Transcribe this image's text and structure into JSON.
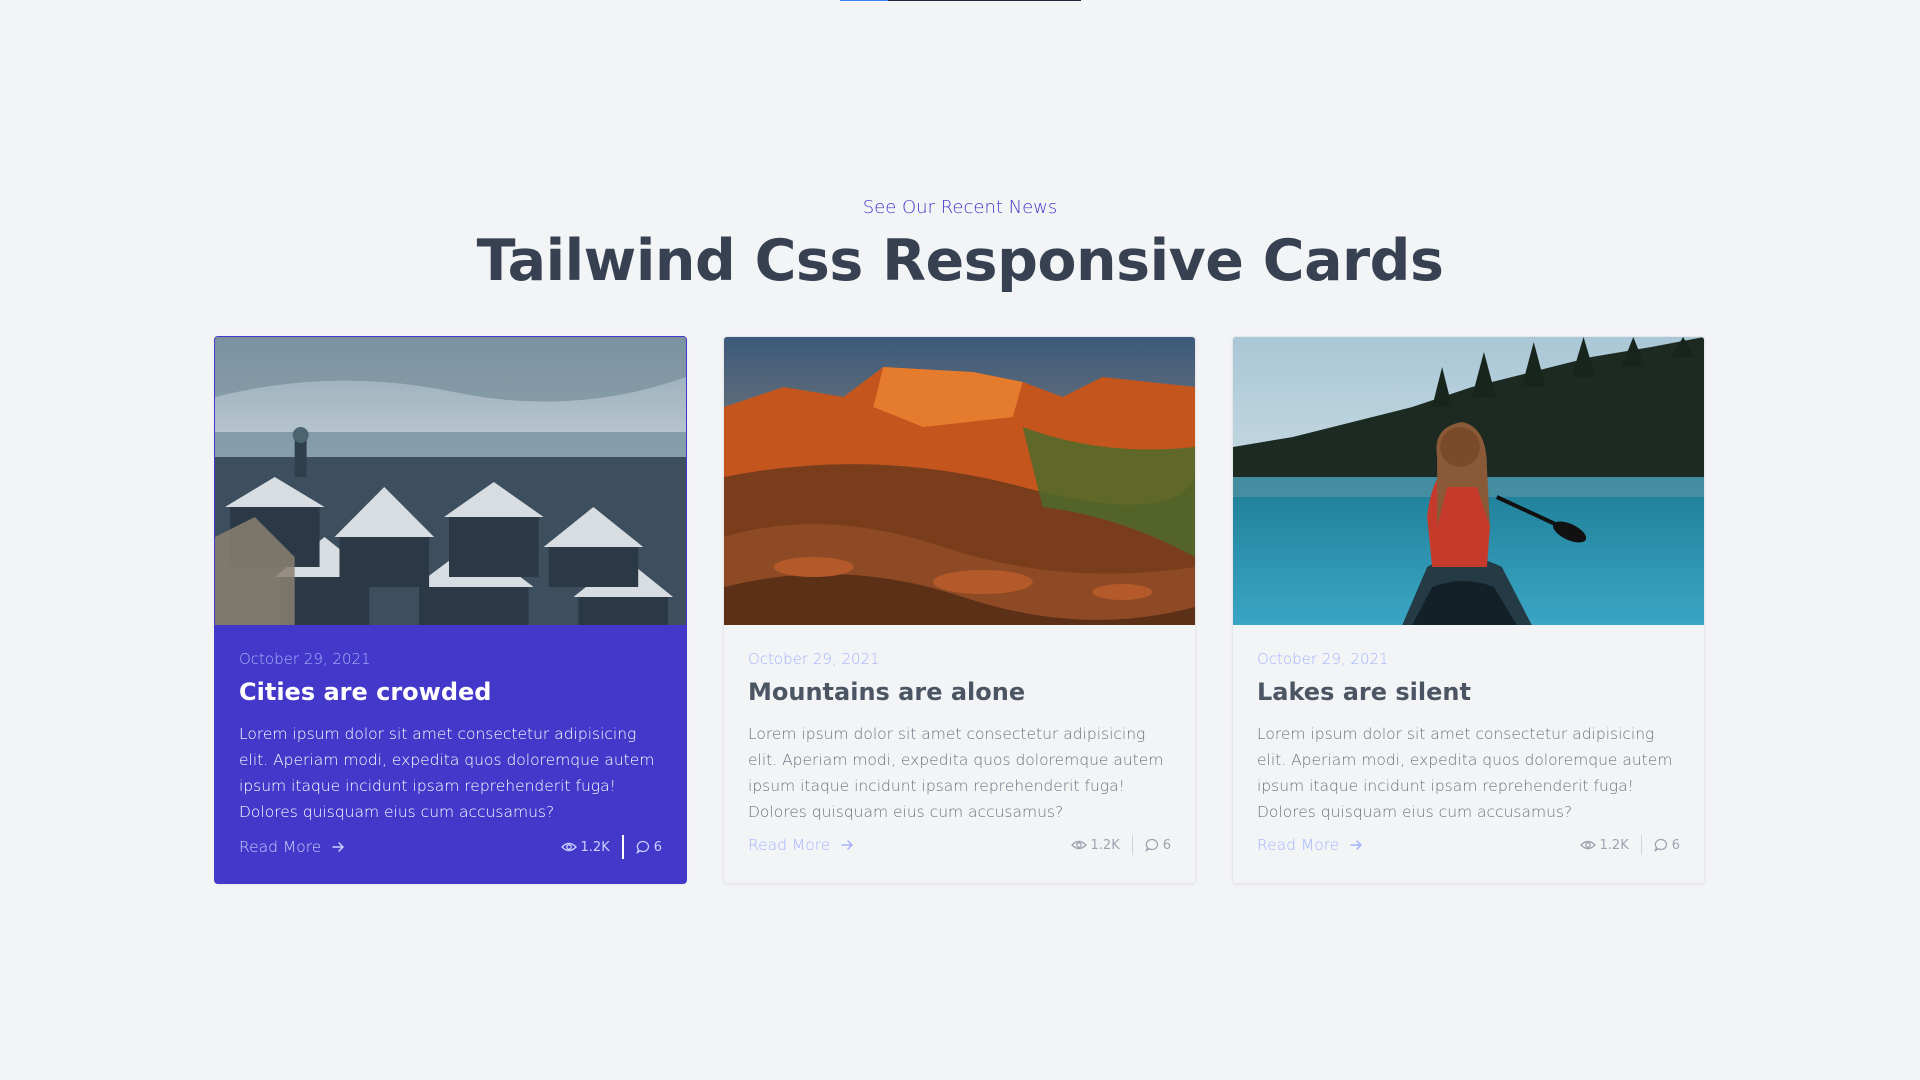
{
  "header": {
    "subtitle": "See Our Recent News",
    "title": "Tailwind Css Responsive Cards"
  },
  "cards": [
    {
      "date": "October 29, 2021",
      "title": "Cities are crowded",
      "text": "Lorem ipsum dolor sit amet consectetur adipisicing elit. Aperiam modi, expedita quos doloremque autem ipsum itaque incidunt ipsam reprehenderit fuga! Dolores quisquam eius cum accusamus?",
      "read_more": "Read More",
      "views": "1.2K",
      "comments": "6",
      "image": "snowy-city-rooftops",
      "active": true
    },
    {
      "date": "October 29, 2021",
      "title": "Mountains are alone",
      "text": "Lorem ipsum dolor sit amet consectetur adipisicing elit. Aperiam modi, expedita quos doloremque autem ipsum itaque incidunt ipsam reprehenderit fuga! Dolores quisquam eius cum accusamus?",
      "read_more": "Read More",
      "views": "1.2K",
      "comments": "6",
      "image": "red-rock-canyon",
      "active": false
    },
    {
      "date": "October 29, 2021",
      "title": "Lakes are silent",
      "text": "Lorem ipsum dolor sit amet consectetur adipisicing elit. Aperiam modi, expedita quos doloremque autem ipsum itaque incidunt ipsam reprehenderit fuga! Dolores quisquam eius cum accusamus?",
      "read_more": "Read More",
      "views": "1.2K",
      "comments": "6",
      "image": "woman-in-canoe-on-lake",
      "active": false
    }
  ],
  "colors": {
    "accent": "#4338ca",
    "background": "#f3f4f6",
    "date": "#a5b4fc",
    "heading": "#374151"
  },
  "icons": {
    "views": "eye-icon",
    "comments": "comment-icon",
    "read_more": "arrow-right-icon"
  }
}
